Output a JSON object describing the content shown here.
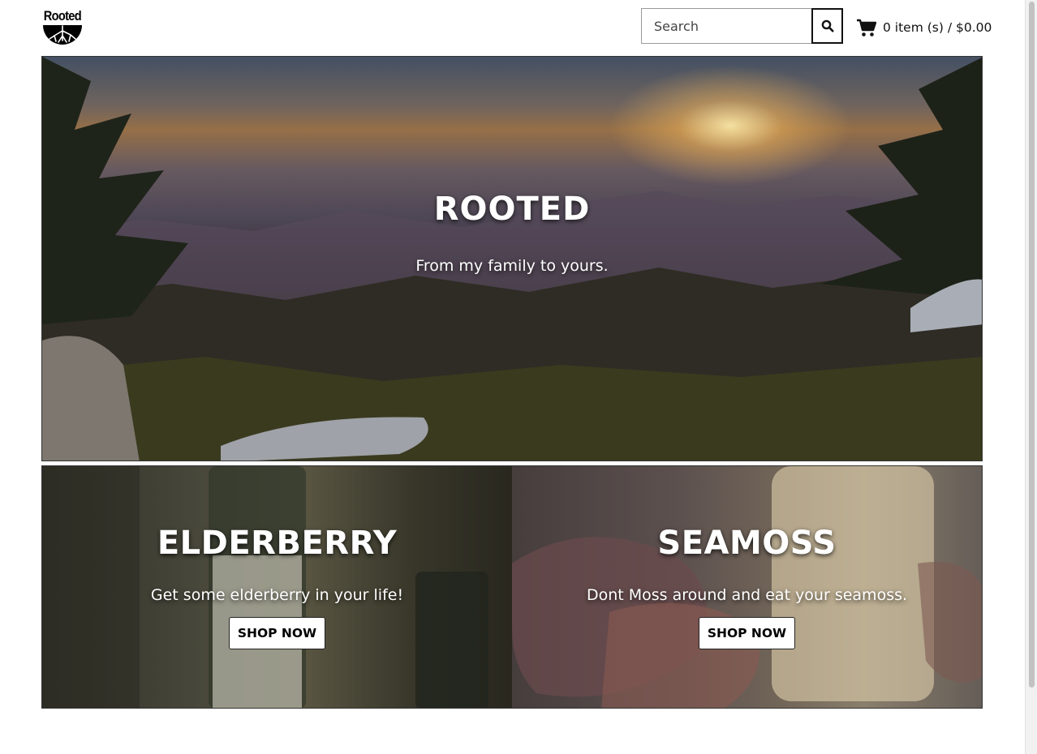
{
  "header": {
    "logo_text": "Rooted",
    "search": {
      "placeholder": "Search"
    },
    "cart": {
      "label": "0 item (s) / $0.00"
    }
  },
  "hero": {
    "title": "ROOTED",
    "subtitle": "From my family to yours."
  },
  "panels": [
    {
      "title": "ELDERBERRY",
      "subtitle": "Get some elderberry in your life!",
      "button": "SHOP NOW"
    },
    {
      "title": "SEAMOSS",
      "subtitle": "Dont Moss around and eat your seamoss.",
      "button": "SHOP NOW"
    }
  ]
}
